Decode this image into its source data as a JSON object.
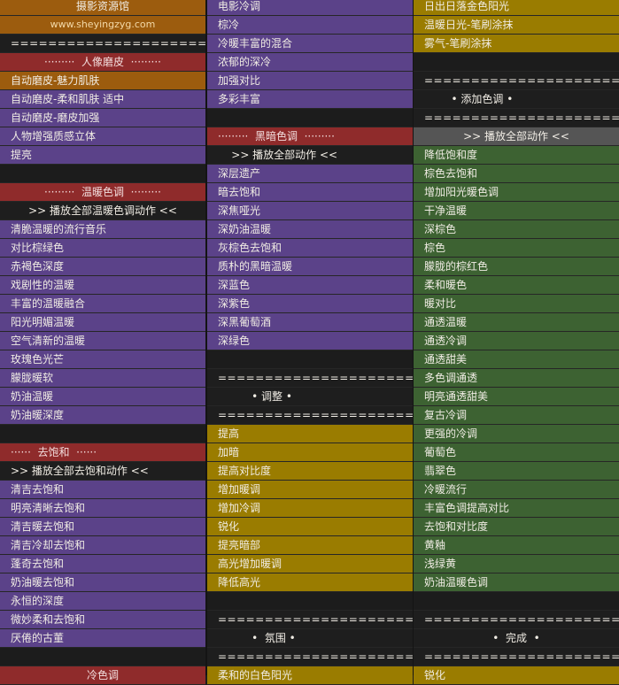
{
  "colors": {
    "orange": "#9c5c0e",
    "purple": "#5b4289",
    "red": "#8f2b2b",
    "yellow": "#9a7c00",
    "green": "#3d6232",
    "dark": "#1e1e1e",
    "gray": "#555555"
  },
  "columns": [
    {
      "rows": [
        {
          "type": "orange",
          "center": true,
          "text": "摄影资源馆"
        },
        {
          "type": "orange",
          "center": true,
          "small": true,
          "text": "www.sheyingzyg.com"
        },
        {
          "type": "eq",
          "text": "======================"
        },
        {
          "type": "red",
          "center": true,
          "text": "·········  人像磨皮  ·········"
        },
        {
          "type": "orange",
          "text": "自动磨皮-魅力肌肤"
        },
        {
          "type": "purple",
          "text": "自动磨皮-柔和肌肤 适中"
        },
        {
          "type": "purple",
          "text": "自动磨皮-磨皮加强"
        },
        {
          "type": "purple",
          "text": "人物增强质感立体"
        },
        {
          "type": "purple",
          "text": "提亮"
        },
        {
          "type": "blank",
          "text": ""
        },
        {
          "type": "red",
          "center": true,
          "text": "·········  温暖色调  ·········"
        },
        {
          "type": "dark",
          "center": true,
          "text": ">> 播放全部温暖色调动作 <<"
        },
        {
          "type": "purple",
          "text": "清脆温暖的流行音乐"
        },
        {
          "type": "purple",
          "text": "对比棕绿色"
        },
        {
          "type": "purple",
          "text": "赤褐色深度"
        },
        {
          "type": "purple",
          "text": "戏剧性的温暖"
        },
        {
          "type": "purple",
          "text": "丰富的温暖融合"
        },
        {
          "type": "purple",
          "text": "阳光明媚温暖"
        },
        {
          "type": "purple",
          "text": "空气清新的温暖"
        },
        {
          "type": "purple",
          "text": "玫瑰色光芒"
        },
        {
          "type": "purple",
          "text": "朦胧暖软"
        },
        {
          "type": "purple",
          "text": "奶油温暖"
        },
        {
          "type": "purple",
          "text": "奶油暖深度"
        },
        {
          "type": "blank",
          "text": ""
        },
        {
          "type": "red",
          "text": "······  去饱和  ······"
        },
        {
          "type": "dark",
          "text": ">> 播放全部去饱和动作 <<"
        },
        {
          "type": "purple",
          "text": "清吉去饱和"
        },
        {
          "type": "purple",
          "text": "明亮清晰去饱和"
        },
        {
          "type": "purple",
          "text": "清吉暖去饱和"
        },
        {
          "type": "purple",
          "text": "清吉冷却去饱和"
        },
        {
          "type": "purple",
          "text": "蓬奇去饱和"
        },
        {
          "type": "purple",
          "text": "奶油暖去饱和"
        },
        {
          "type": "purple",
          "text": "永恒的深度"
        },
        {
          "type": "purple",
          "text": "微妙柔和去饱和"
        },
        {
          "type": "purple",
          "text": "厌倦的古董"
        },
        {
          "type": "blank",
          "text": ""
        },
        {
          "type": "red",
          "center": true,
          "text": "冷色调"
        }
      ]
    },
    {
      "rows": [
        {
          "type": "purple",
          "text": "电影冷调"
        },
        {
          "type": "purple",
          "text": "棕冷"
        },
        {
          "type": "purple",
          "text": "冷暖丰富的混合"
        },
        {
          "type": "purple",
          "text": "浓郁的深冷"
        },
        {
          "type": "purple",
          "text": "加强对比"
        },
        {
          "type": "purple",
          "text": "多彩丰富"
        },
        {
          "type": "blank",
          "text": ""
        },
        {
          "type": "red",
          "text": "·········  黑暗色调  ·········"
        },
        {
          "type": "dark",
          "text": "    >> 播放全部动作 <<"
        },
        {
          "type": "purple",
          "text": "深层遗产"
        },
        {
          "type": "purple",
          "text": "暗去饱和"
        },
        {
          "type": "purple",
          "text": "深焦哑光"
        },
        {
          "type": "purple",
          "text": "深奶油温暖"
        },
        {
          "type": "purple",
          "text": "灰棕色去饱和"
        },
        {
          "type": "purple",
          "text": "质朴的黑暗温暖"
        },
        {
          "type": "purple",
          "text": "深蓝色"
        },
        {
          "type": "purple",
          "text": "深紫色"
        },
        {
          "type": "purple",
          "text": "深黑葡萄酒"
        },
        {
          "type": "purple",
          "text": "深绿色"
        },
        {
          "type": "blank",
          "text": ""
        },
        {
          "type": "eq",
          "text": "======================"
        },
        {
          "type": "dark",
          "text": "          • 调整 •"
        },
        {
          "type": "eq",
          "text": "======================"
        },
        {
          "type": "yellow",
          "text": "提高"
        },
        {
          "type": "yellow",
          "text": "加暗"
        },
        {
          "type": "yellow",
          "text": "提高对比度"
        },
        {
          "type": "yellow",
          "text": "增加暖调"
        },
        {
          "type": "yellow",
          "text": "增加冷调"
        },
        {
          "type": "yellow",
          "text": "锐化"
        },
        {
          "type": "yellow",
          "text": "提亮暗部"
        },
        {
          "type": "yellow",
          "text": "高光增加暖调"
        },
        {
          "type": "yellow",
          "text": "降低高光"
        },
        {
          "type": "blank",
          "text": ""
        },
        {
          "type": "eq",
          "text": "======================"
        },
        {
          "type": "dark",
          "text": "          •  氛围 •"
        },
        {
          "type": "eq",
          "text": "======================"
        },
        {
          "type": "yellow",
          "text": "柔和的白色阳光"
        }
      ]
    },
    {
      "rows": [
        {
          "type": "yellow",
          "text": "日出日落金色阳光"
        },
        {
          "type": "yellow",
          "text": "温暖日光-笔刷涂抹"
        },
        {
          "type": "yellow",
          "text": "雾气-笔刷涂抹"
        },
        {
          "type": "blank",
          "text": ""
        },
        {
          "type": "eq",
          "text": "======================"
        },
        {
          "type": "dark",
          "text": "        • 添加色调 •"
        },
        {
          "type": "eq",
          "text": "======================"
        },
        {
          "type": "gray",
          "center": true,
          "text": ">> 播放全部动作 <<"
        },
        {
          "type": "green",
          "text": "降低饱和度"
        },
        {
          "type": "green",
          "text": "棕色去饱和"
        },
        {
          "type": "green",
          "text": "增加阳光暖色调"
        },
        {
          "type": "green",
          "text": "干净温暖"
        },
        {
          "type": "green",
          "text": "深棕色"
        },
        {
          "type": "green",
          "text": "棕色"
        },
        {
          "type": "green",
          "text": "朦胧的棕红色"
        },
        {
          "type": "green",
          "text": "柔和暖色"
        },
        {
          "type": "green",
          "text": "暖对比"
        },
        {
          "type": "green",
          "text": "通透温暖"
        },
        {
          "type": "green",
          "text": "通透冷调"
        },
        {
          "type": "green",
          "text": "通透甜美"
        },
        {
          "type": "green",
          "text": "多色调通透"
        },
        {
          "type": "green",
          "text": "明亮通透甜美"
        },
        {
          "type": "green",
          "text": "复古冷调"
        },
        {
          "type": "green",
          "text": "更强的冷调"
        },
        {
          "type": "green",
          "text": "葡萄色"
        },
        {
          "type": "green",
          "text": "翡翠色"
        },
        {
          "type": "green",
          "text": "冷暖流行"
        },
        {
          "type": "green",
          "text": "丰富色调提高对比"
        },
        {
          "type": "green",
          "text": "去饱和对比度"
        },
        {
          "type": "green",
          "text": "黄釉"
        },
        {
          "type": "green",
          "text": "浅绿黄"
        },
        {
          "type": "green",
          "text": "奶油温暖色调"
        },
        {
          "type": "blank",
          "text": ""
        },
        {
          "type": "eq",
          "text": "======================"
        },
        {
          "type": "dark",
          "center": true,
          "text": "•  完成  •"
        },
        {
          "type": "eq",
          "text": "======================"
        },
        {
          "type": "yellow",
          "text": "锐化"
        }
      ]
    }
  ]
}
